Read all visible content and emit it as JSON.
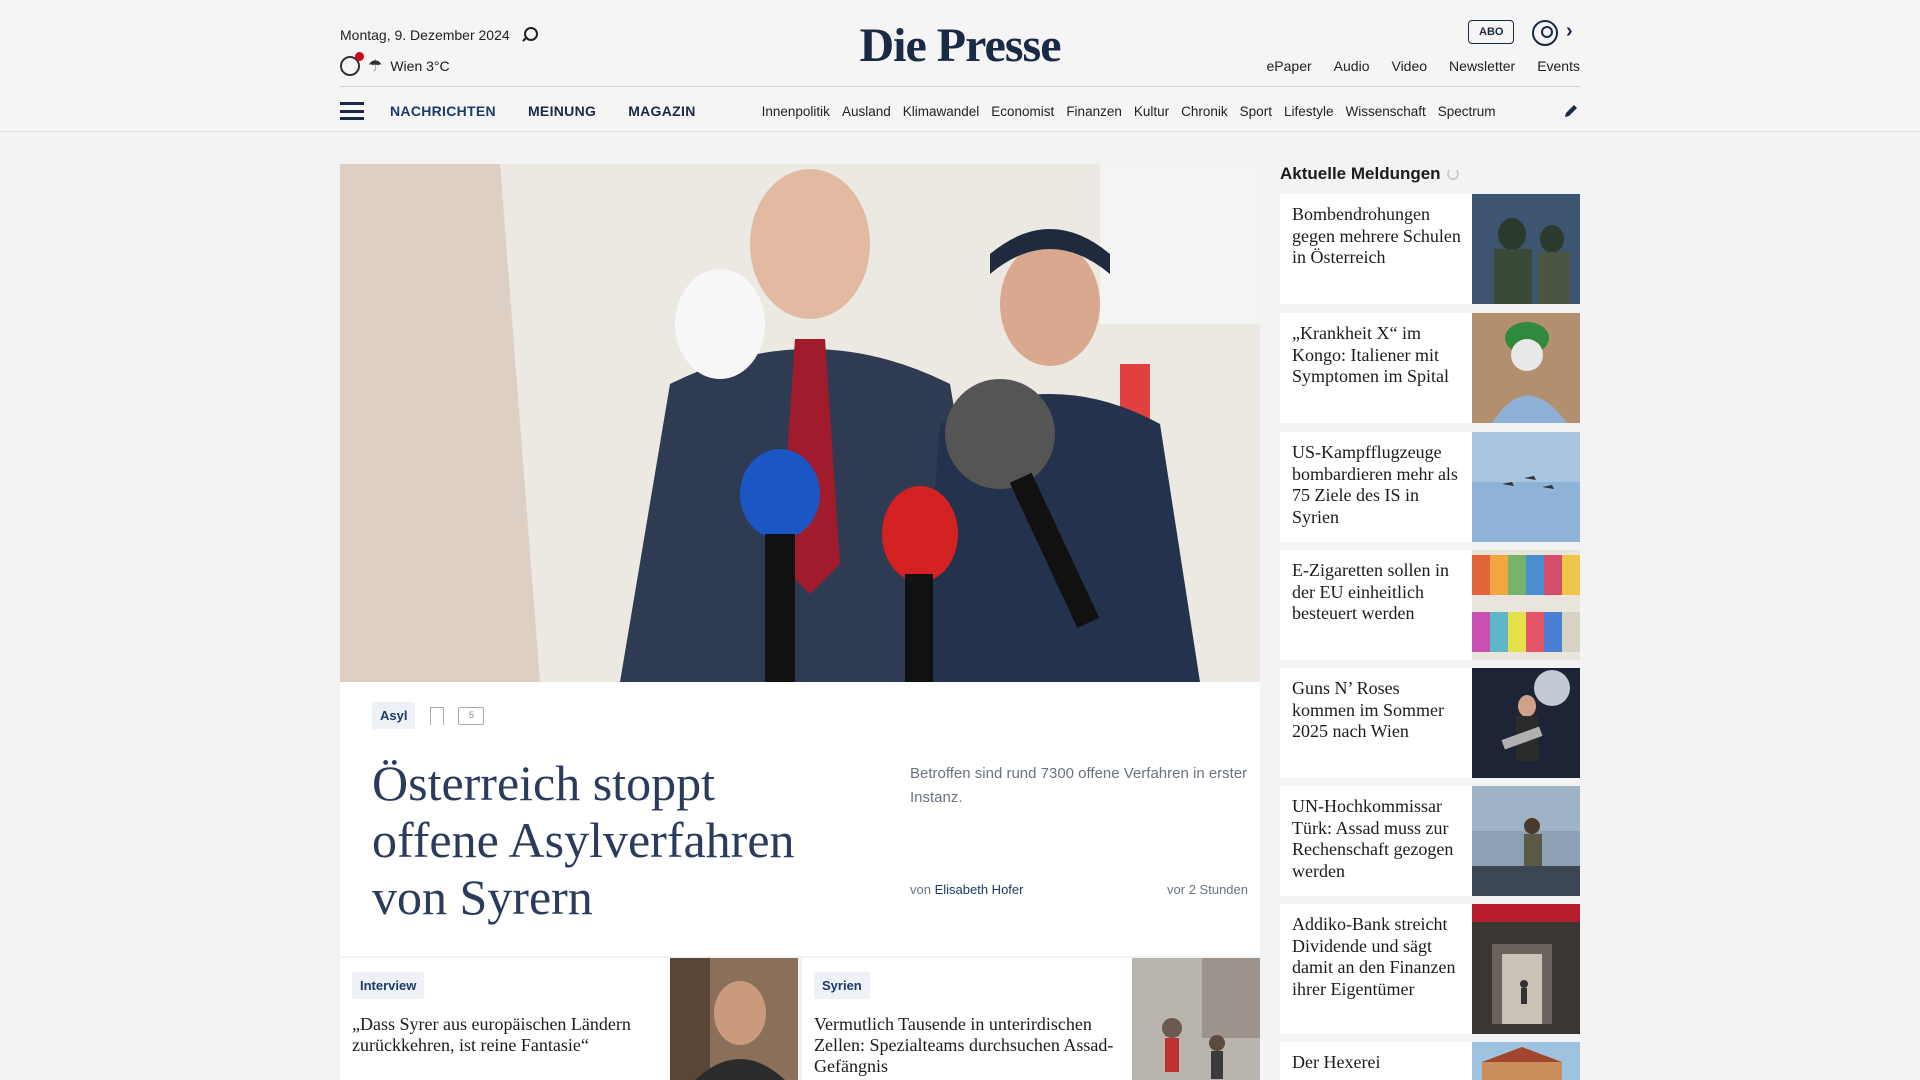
{
  "header": {
    "date": "Montag, 9. Dezember 2024",
    "weather": "Wien 3°C",
    "logo": "Die Presse",
    "abo": "ABO",
    "links": [
      "ePaper",
      "Audio",
      "Video",
      "Newsletter",
      "Events"
    ]
  },
  "nav": {
    "main": [
      "NACHRICHTEN",
      "MEINUNG",
      "MAGAZIN"
    ],
    "sub": [
      "Innenpolitik",
      "Ausland",
      "Klimawandel",
      "Economist",
      "Finanzen",
      "Kultur",
      "Chronik",
      "Sport",
      "Lifestyle",
      "Wissenschaft",
      "Spectrum"
    ]
  },
  "hero": {
    "tag": "Asyl",
    "comments": "5",
    "headline": "Österreich stoppt offene Asylverfahren von Syrern",
    "lead": "Betroffen sind rund 7300 offene Verfahren in erster Instanz.",
    "byline_prefix": "von",
    "author": "Elisabeth Hofer",
    "time": "vor 2 Stunden"
  },
  "cards": [
    {
      "tag": "Interview",
      "title": "„Dass Syrer aus europäischen Ländern zurückkehren, ist reine Fantasie“"
    },
    {
      "tag": "Syrien",
      "title": "Vermutlich Tausende in unterirdischen Zellen: Spezialteams durchsuchen Assad-Gefängnis"
    }
  ],
  "news": {
    "heading": "Aktuelle Meldungen",
    "items": [
      {
        "title": "Bombendrohungen gegen mehrere Schulen in Österreich"
      },
      {
        "title": "„Krankheit X“ im Kongo: Italiener mit Symptomen im Spital"
      },
      {
        "title": "US-Kampfflugzeuge bombardieren mehr als 75 Ziele des IS in Syrien"
      },
      {
        "title": "E-Zigaretten sollen in der EU einheitlich besteuert werden"
      },
      {
        "title": "Guns N’ Roses kommen im Sommer 2025 nach Wien"
      },
      {
        "title": "UN-Hochkommissar Türk: Assad muss zur Rechenschaft gezogen werden"
      },
      {
        "title": "Addiko-Bank streicht Dividende und sägt damit an den Finanzen ihrer Eigentümer"
      },
      {
        "title": "Der Hexerei"
      }
    ]
  },
  "colors": {
    "brand": "#1a2a44",
    "accent": "#1a3b6b",
    "alert": "#d0021b"
  }
}
